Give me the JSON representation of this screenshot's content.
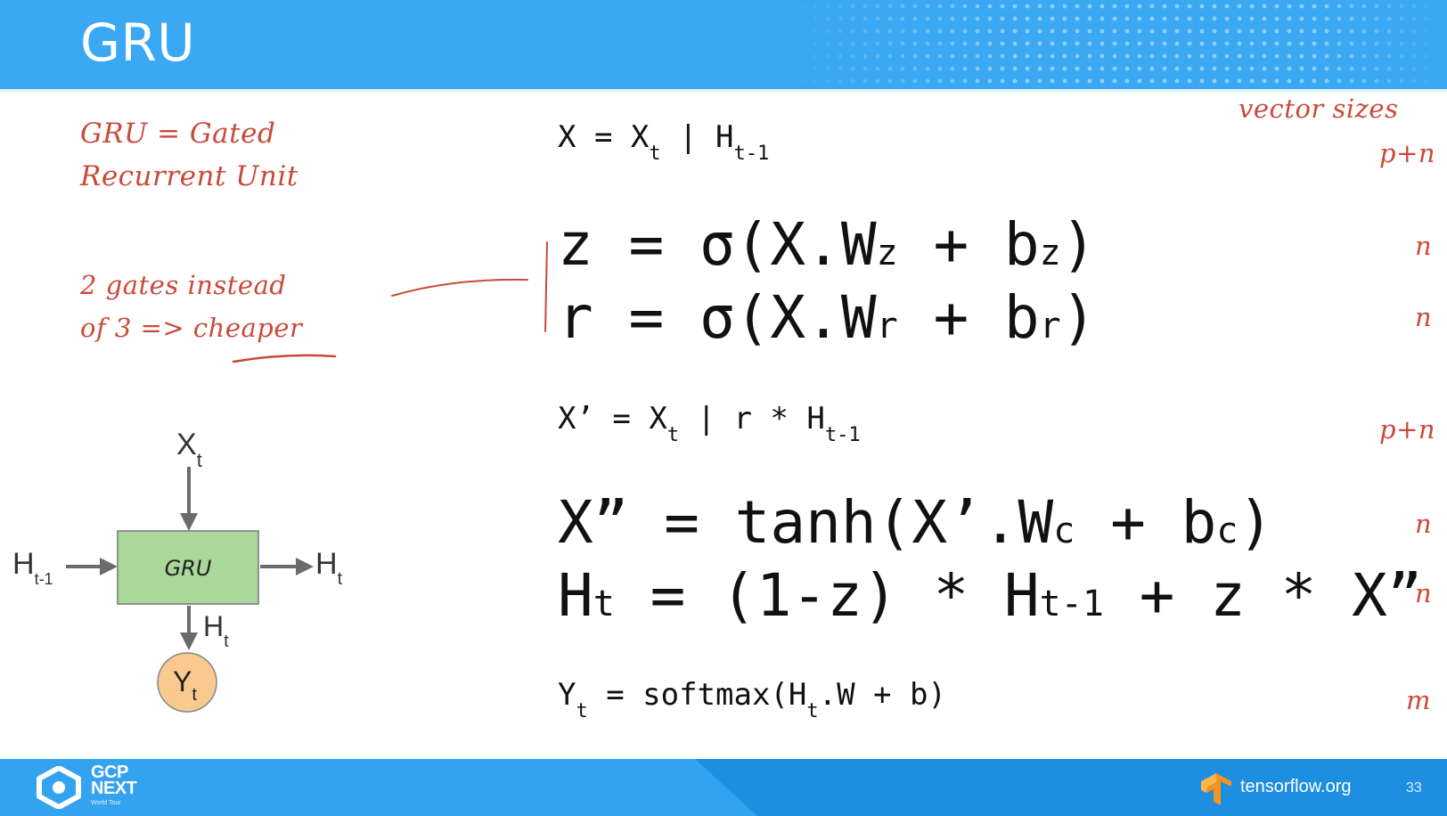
{
  "header": {
    "title": "GRU"
  },
  "notes": {
    "gru_line1": "GRU = Gated",
    "gru_line2": "Recurrent Unit",
    "gates_line1": "2 gates instead",
    "gates_line2_prefix": "of 3 => ",
    "gates_line2_emph": "cheaper",
    "vector_sizes": "vector sizes"
  },
  "equations": {
    "eq1": {
      "lhs": "X = X",
      "sub1": "t",
      "mid": " | H",
      "sub2": "t-1",
      "size": "p+n"
    },
    "eq2": {
      "a": "z = σ(X.W",
      "sub1": "z",
      "b": " + b",
      "sub2": "z",
      "c": ")",
      "size": "n"
    },
    "eq3": {
      "a": "r = σ(X.W",
      "sub1": "r",
      "b": " + b",
      "sub2": "r",
      "c": ")",
      "size": "n"
    },
    "eq4": {
      "a": "X’ = X",
      "sub1": "t",
      "b": " | r * H",
      "sub2": "t-1",
      "size": "p+n"
    },
    "eq5": {
      "a": "X” = tanh(X’.W",
      "sub1": "c",
      "b": " + b",
      "sub2": "c",
      "c": ")",
      "size": "n"
    },
    "eq6": {
      "a": "H",
      "sub1": "t",
      "b": " = (1-z) * H",
      "sub2": "t-1",
      "c": " + z * X”",
      "size": "n"
    },
    "eq7": {
      "a": "Y",
      "sub1": "t",
      "b": " = softmax(H",
      "sub2": "t",
      "c": ".W + b)",
      "size": "m"
    }
  },
  "diagram": {
    "box_label": "GRU",
    "input_top": "X",
    "input_top_sub": "t",
    "input_left": "H",
    "input_left_sub": "t-1",
    "output_right": "H",
    "output_right_sub": "t",
    "output_bottom": "H",
    "output_bottom_sub": "t",
    "circle": "Y",
    "circle_sub": "t",
    "box_color": "#a9d89a",
    "circle_color": "#f9c990"
  },
  "footer": {
    "gcp_line1": "GCP",
    "gcp_line2": "NEXT",
    "gcp_small": "World Tour",
    "site": "tensorflow.org",
    "page": "33"
  },
  "colors": {
    "header": "#3aa8f2",
    "footer": "#1e8fe0",
    "annotation": "#c94a3a"
  }
}
